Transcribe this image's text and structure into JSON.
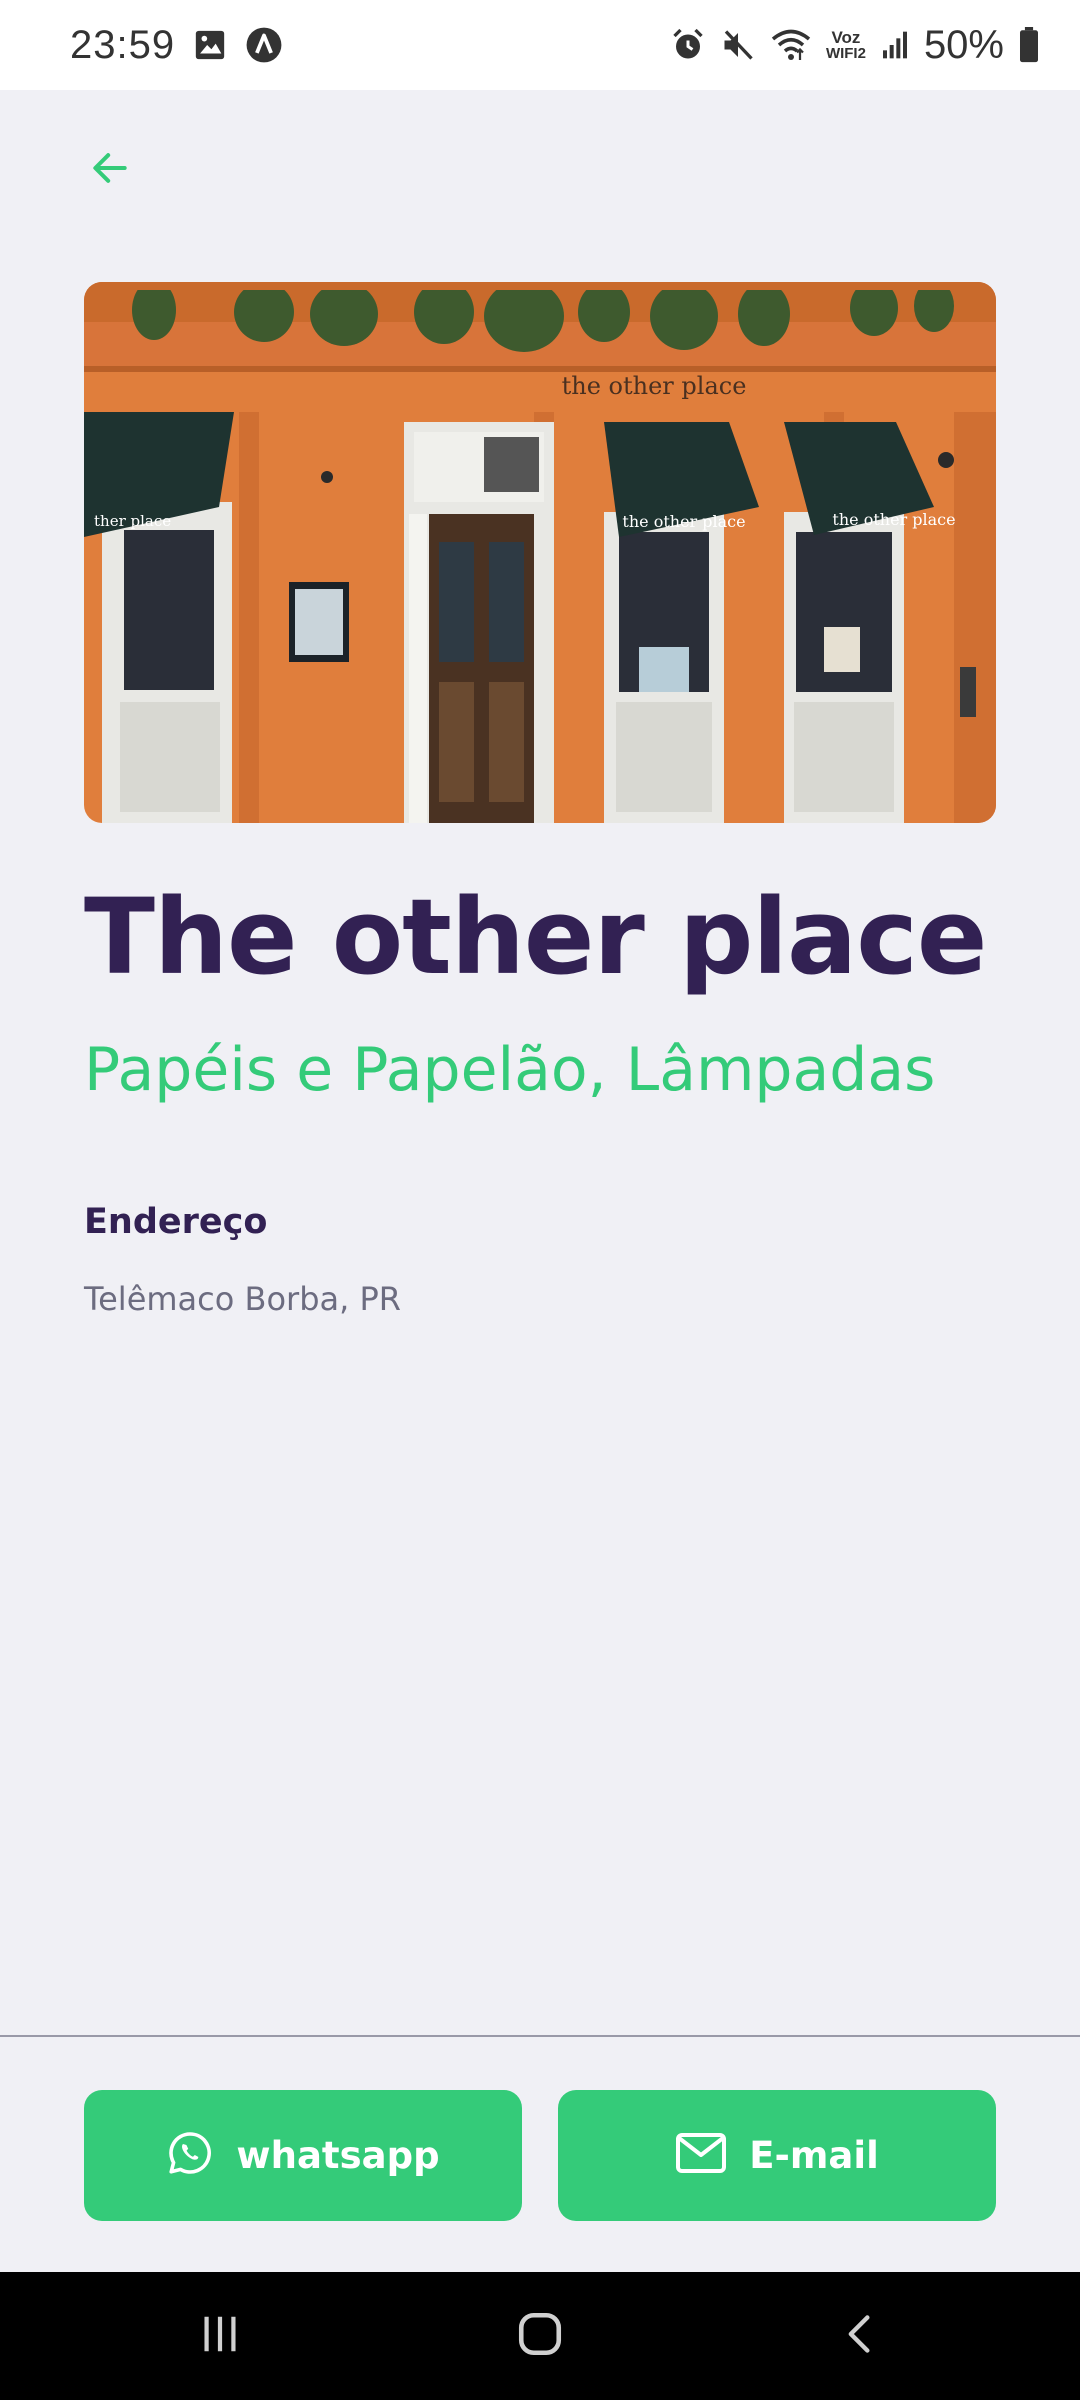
{
  "status_bar": {
    "time": "23:59",
    "battery_text": "50%",
    "voz_label": "Voz",
    "wifi_label": "WIFI2",
    "left_icons": [
      "image-icon",
      "app-a-icon"
    ],
    "right_icons": [
      "alarm-icon",
      "mute-icon",
      "wifi-icon",
      "signal-icon",
      "battery-icon"
    ]
  },
  "header": {
    "back_icon": "arrow-left-icon"
  },
  "point": {
    "name": "The other place",
    "items": "Papéis e Papelão, Lâmpadas",
    "address_label": "Endereço",
    "address_value": "Telêmaco Borba, PR",
    "photo_sign_text": "the other place",
    "awning_text": "the other place",
    "awning_text_left": "ther place"
  },
  "footer": {
    "whatsapp_label": "whatsapp",
    "email_label": "E-mail"
  },
  "colors": {
    "background": "#F0F0F5",
    "primary_green": "#34CB79",
    "title_purple": "#322153",
    "text_gray": "#6C6C80"
  }
}
